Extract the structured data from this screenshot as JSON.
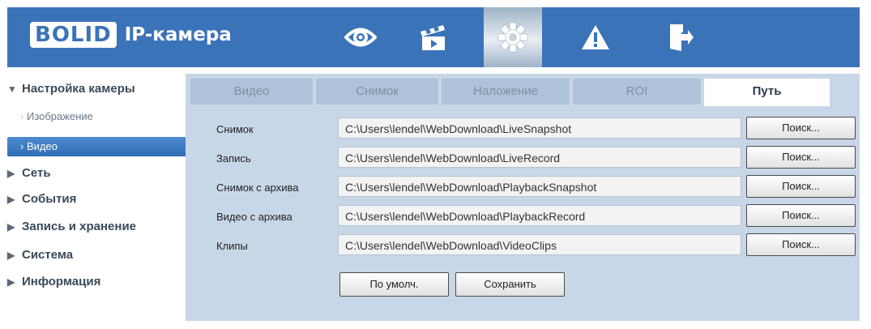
{
  "header": {
    "brand": "BOLID",
    "title": "IP-камера",
    "nav": [
      {
        "icon": "eye-icon"
      },
      {
        "icon": "clapperboard-icon"
      },
      {
        "icon": "gear-icon",
        "active": true
      },
      {
        "icon": "warning-icon"
      },
      {
        "icon": "exit-icon"
      }
    ]
  },
  "sidebar": {
    "items": [
      {
        "label": "Настройка камеры",
        "expanded": true
      },
      {
        "label": "Изображение"
      },
      {
        "label": "Видео",
        "selected": true
      },
      {
        "label": "Сеть"
      },
      {
        "label": "События"
      },
      {
        "label": "Запись и хранение"
      },
      {
        "label": "Система"
      },
      {
        "label": "Информация"
      }
    ]
  },
  "tabs": [
    {
      "label": "Видео"
    },
    {
      "label": "Снимок"
    },
    {
      "label": "Наложение"
    },
    {
      "label": "ROI"
    },
    {
      "label": "Путь",
      "active": true
    }
  ],
  "paths": [
    {
      "label": "Снимок",
      "value": "C:\\Users\\lendel\\WebDownload\\LiveSnapshot",
      "button": "Поиск..."
    },
    {
      "label": "Запись",
      "value": "C:\\Users\\lendel\\WebDownload\\LiveRecord",
      "button": "Поиск..."
    },
    {
      "label": "Снимок с архива",
      "value": "C:\\Users\\lendel\\WebDownload\\PlaybackSnapshot",
      "button": "Поиск..."
    },
    {
      "label": "Видео с архива",
      "value": "C:\\Users\\lendel\\WebDownload\\PlaybackRecord",
      "button": "Поиск..."
    },
    {
      "label": "Клипы",
      "value": "C:\\Users\\lendel\\WebDownload\\VideoClips",
      "button": "Поиск..."
    }
  ],
  "actions": {
    "default_label": "По умолч.",
    "save_label": "Сохранить"
  },
  "colors": {
    "header": "#3b73b9",
    "content_bg": "#c8d7e8",
    "selected_item": "#2f6db4"
  }
}
